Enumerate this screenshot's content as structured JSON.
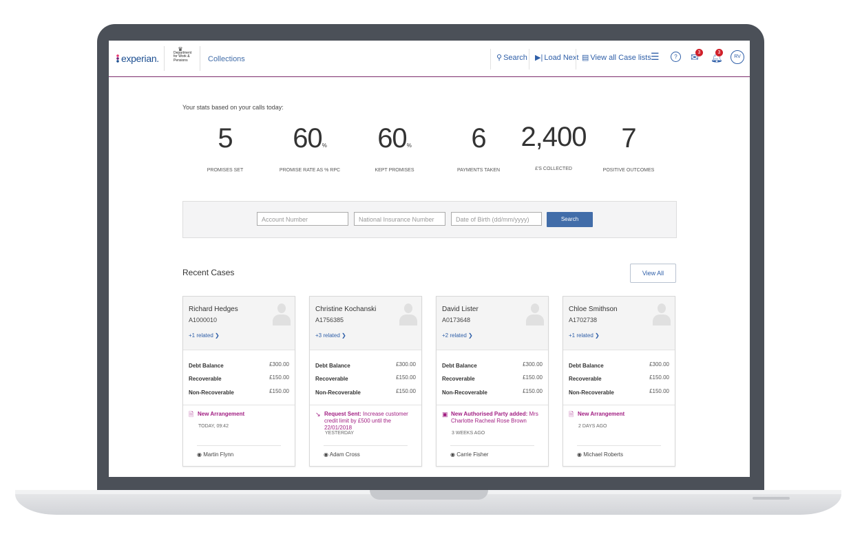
{
  "header": {
    "brand": "experian.",
    "dept_lines": [
      "Department",
      "for Work &",
      "Pensions"
    ],
    "app_title": "Collections",
    "nav": {
      "search": "Search",
      "load_next": "Load Next",
      "view_all_case_lists": "View all Case lists"
    },
    "messages_badge": "3",
    "notifications_badge": "3",
    "user_initials": "RV"
  },
  "stats": {
    "intro": "Your stats based on your calls today:",
    "items": [
      {
        "value": "5",
        "suffix": "",
        "label": "PROMISES SET"
      },
      {
        "value": "60",
        "suffix": "%",
        "label": "PROMISE RATE AS % RPC"
      },
      {
        "value": "60",
        "suffix": "%",
        "label": "KEPT PROMISES"
      },
      {
        "value": "6",
        "suffix": "",
        "label": "PAYMENTS TAKEN"
      },
      {
        "value": "2,400",
        "suffix": "",
        "label": "£'S COLLECTED"
      },
      {
        "value": "7",
        "suffix": "",
        "label": "POSITIVE OUTCOMES"
      }
    ]
  },
  "search": {
    "account_placeholder": "Account Number",
    "ni_placeholder": "National Insurance Number",
    "dob_placeholder": "Date of Birth (dd/mm/yyyy)",
    "button": "Search"
  },
  "recent": {
    "title": "Recent Cases",
    "view_all": "View All",
    "labels": {
      "debt": "Debt Balance",
      "recoverable": "Recoverable",
      "non_recoverable": "Non-Recoverable"
    },
    "cases": [
      {
        "name": "Richard Hedges",
        "account": "A1000010",
        "related": "+1 related",
        "debt": "£300.00",
        "recoverable": "£150.00",
        "non_recoverable": "£150.00",
        "activity_icon": "document-icon",
        "activity_title": "New Arrangement",
        "activity_detail": "",
        "activity_time": "TODAY, 09:42",
        "agent": "Martin Flynn"
      },
      {
        "name": "Christine Kochanski",
        "account": "A1756385",
        "related": "+3 related",
        "debt": "£300.00",
        "recoverable": "£150.00",
        "non_recoverable": "£150.00",
        "activity_icon": "trend-arrow-icon",
        "activity_title": "Request Sent:",
        "activity_detail": "Increase customer credit limit by £500 until the 22/01/2018",
        "activity_time": "YESTERDAY",
        "agent": "Adam Cross"
      },
      {
        "name": "David Lister",
        "account": "A0173648",
        "related": "+2 related",
        "debt": "£300.00",
        "recoverable": "£150.00",
        "non_recoverable": "£150.00",
        "activity_icon": "contact-card-icon",
        "activity_title": "New Authorised Party added:",
        "activity_detail": "Mrs Charlotte Racheal Rose Brown",
        "activity_time": "3 WEEKS AGO",
        "agent": "Carrie Fisher"
      },
      {
        "name": "Chloe Smithson",
        "account": "A1702738",
        "related": "+1 related",
        "debt": "£300.00",
        "recoverable": "£150.00",
        "non_recoverable": "£150.00",
        "activity_icon": "document-icon",
        "activity_title": "New Arrangement",
        "activity_detail": "",
        "activity_time": "2 DAYS AGO",
        "agent": "Michael Roberts"
      }
    ]
  },
  "colors": {
    "accent": "#426da9",
    "activity": "#a11e82",
    "header_rule": "#7b2c6b",
    "badge": "#d0202a"
  }
}
